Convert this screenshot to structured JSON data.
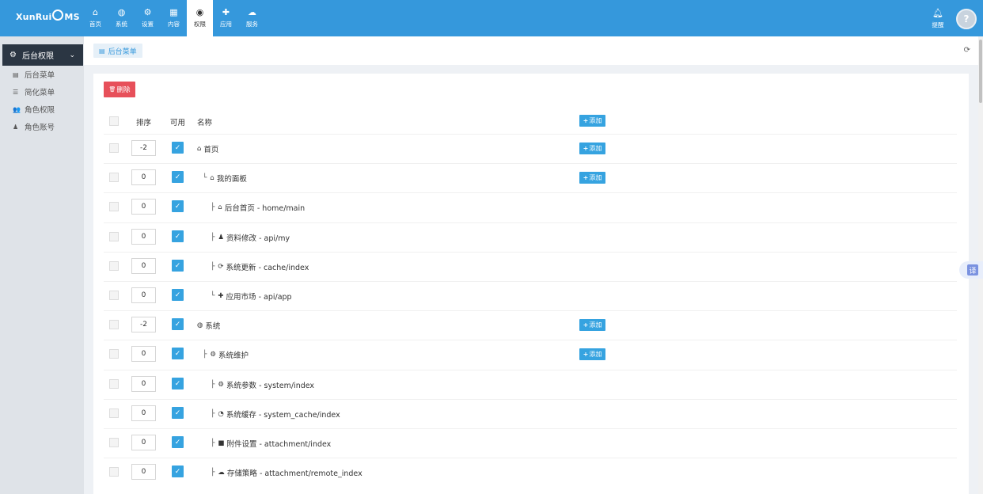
{
  "app": {
    "logo_text_left": "XunRui",
    "logo_text_right": "MS"
  },
  "topnav": [
    {
      "label": "首页",
      "icon": "home-icon",
      "glyph": "⌂"
    },
    {
      "label": "系统",
      "icon": "globe-icon",
      "glyph": "◍"
    },
    {
      "label": "设置",
      "icon": "cogs-icon",
      "glyph": "⚙"
    },
    {
      "label": "内容",
      "icon": "grid-icon",
      "glyph": "▦"
    },
    {
      "label": "权限",
      "icon": "user-circle-icon",
      "glyph": "◉"
    },
    {
      "label": "应用",
      "icon": "puzzle-icon",
      "glyph": "✚"
    },
    {
      "label": "服务",
      "icon": "cloud-icon",
      "glyph": "☁"
    }
  ],
  "header": {
    "notify_label": "提醒",
    "avatar_glyph": "?"
  },
  "sidebar": {
    "section_title": "后台权限",
    "section_icon": "gear-icon",
    "items": [
      {
        "label": "后台菜单",
        "icon": "list-alt-icon",
        "glyph": "▤"
      },
      {
        "label": "简化菜单",
        "icon": "list-icon",
        "glyph": "☰"
      },
      {
        "label": "角色权限",
        "icon": "users-icon",
        "glyph": "👥"
      },
      {
        "label": "角色账号",
        "icon": "user-icon",
        "glyph": "♟"
      }
    ]
  },
  "breadcrumb": {
    "label": "后台菜单",
    "icon": "list-alt-icon"
  },
  "toolbar": {
    "delete_label": "删除",
    "delete_glyph": "🗑"
  },
  "table": {
    "headers": {
      "order": "排序",
      "enabled": "可用",
      "name": "名称"
    },
    "add_label": "添加",
    "rows": [
      {
        "order": "-2",
        "prefix": "",
        "glyph": "⌂",
        "icon": "home-icon",
        "name": "首页",
        "has_add": true
      },
      {
        "order": "0",
        "prefix": "└",
        "glyph": "⌂",
        "icon": "home-icon",
        "name": "我的面板",
        "has_add": true
      },
      {
        "order": "0",
        "prefix": "├",
        "glyph": "⌂",
        "icon": "home-icon",
        "name": "后台首页 - home/main",
        "has_add": false
      },
      {
        "order": "0",
        "prefix": "├",
        "glyph": "♟",
        "icon": "user-icon",
        "name": "资料修改 - api/my",
        "has_add": false
      },
      {
        "order": "0",
        "prefix": "├",
        "glyph": "⟳",
        "icon": "refresh-icon",
        "name": "系统更新 - cache/index",
        "has_add": false
      },
      {
        "order": "0",
        "prefix": "└",
        "glyph": "✚",
        "icon": "puzzle-icon",
        "name": "应用市场 - api/app",
        "has_add": false
      },
      {
        "order": "-2",
        "prefix": "",
        "glyph": "◍",
        "icon": "globe-icon",
        "name": "系统",
        "has_add": true
      },
      {
        "order": "0",
        "prefix": "├",
        "glyph": "⚙",
        "icon": "gear-icon",
        "name": "系统维护",
        "has_add": true
      },
      {
        "order": "0",
        "prefix": "├",
        "glyph": "⚙",
        "icon": "gear-icon",
        "name": "系统参数 - system/index",
        "has_add": false
      },
      {
        "order": "0",
        "prefix": "├",
        "glyph": "◔",
        "icon": "clock-icon",
        "name": "系统缓存 - system_cache/index",
        "has_add": false
      },
      {
        "order": "0",
        "prefix": "├",
        "glyph": "■",
        "icon": "folder-icon",
        "name": "附件设置 - attachment/index",
        "has_add": false
      },
      {
        "order": "0",
        "prefix": "├",
        "glyph": "☁",
        "icon": "cloud-icon",
        "name": "存储策略 - attachment/remote_index",
        "has_add": false
      }
    ]
  },
  "translate_label": "译"
}
